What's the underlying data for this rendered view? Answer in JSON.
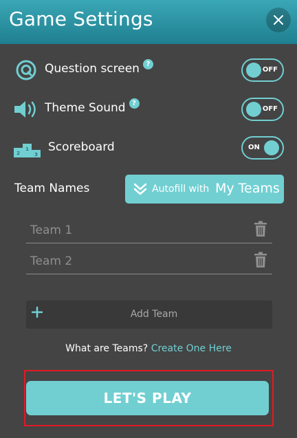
{
  "header": {
    "title": "Game Settings"
  },
  "settings": [
    {
      "label": "Question screen",
      "help": "?",
      "toggle": "OFF"
    },
    {
      "label": "Theme Sound",
      "help": "?",
      "toggle": "OFF"
    },
    {
      "label": "Scoreboard",
      "toggle": "ON"
    }
  ],
  "team_names": {
    "label": "Team Names",
    "autofill_prefix": "Autofill with",
    "autofill_target": "My Teams",
    "teams": [
      {
        "placeholder": "Team 1"
      },
      {
        "placeholder": "Team 2"
      }
    ],
    "add_team": "Add Team"
  },
  "help_text": {
    "question": "What are Teams?",
    "link": "Create One Here"
  },
  "play_button": "LET'S PLAY",
  "colors": {
    "accent": "#71cfd2",
    "header": "#2a93a4",
    "background": "#444444",
    "highlight": "#e01b24"
  },
  "icons": [
    "close-icon",
    "question-screen-icon",
    "speaker-icon",
    "podium-icon",
    "chevron-down-icon",
    "trash-icon",
    "plus-icon"
  ]
}
